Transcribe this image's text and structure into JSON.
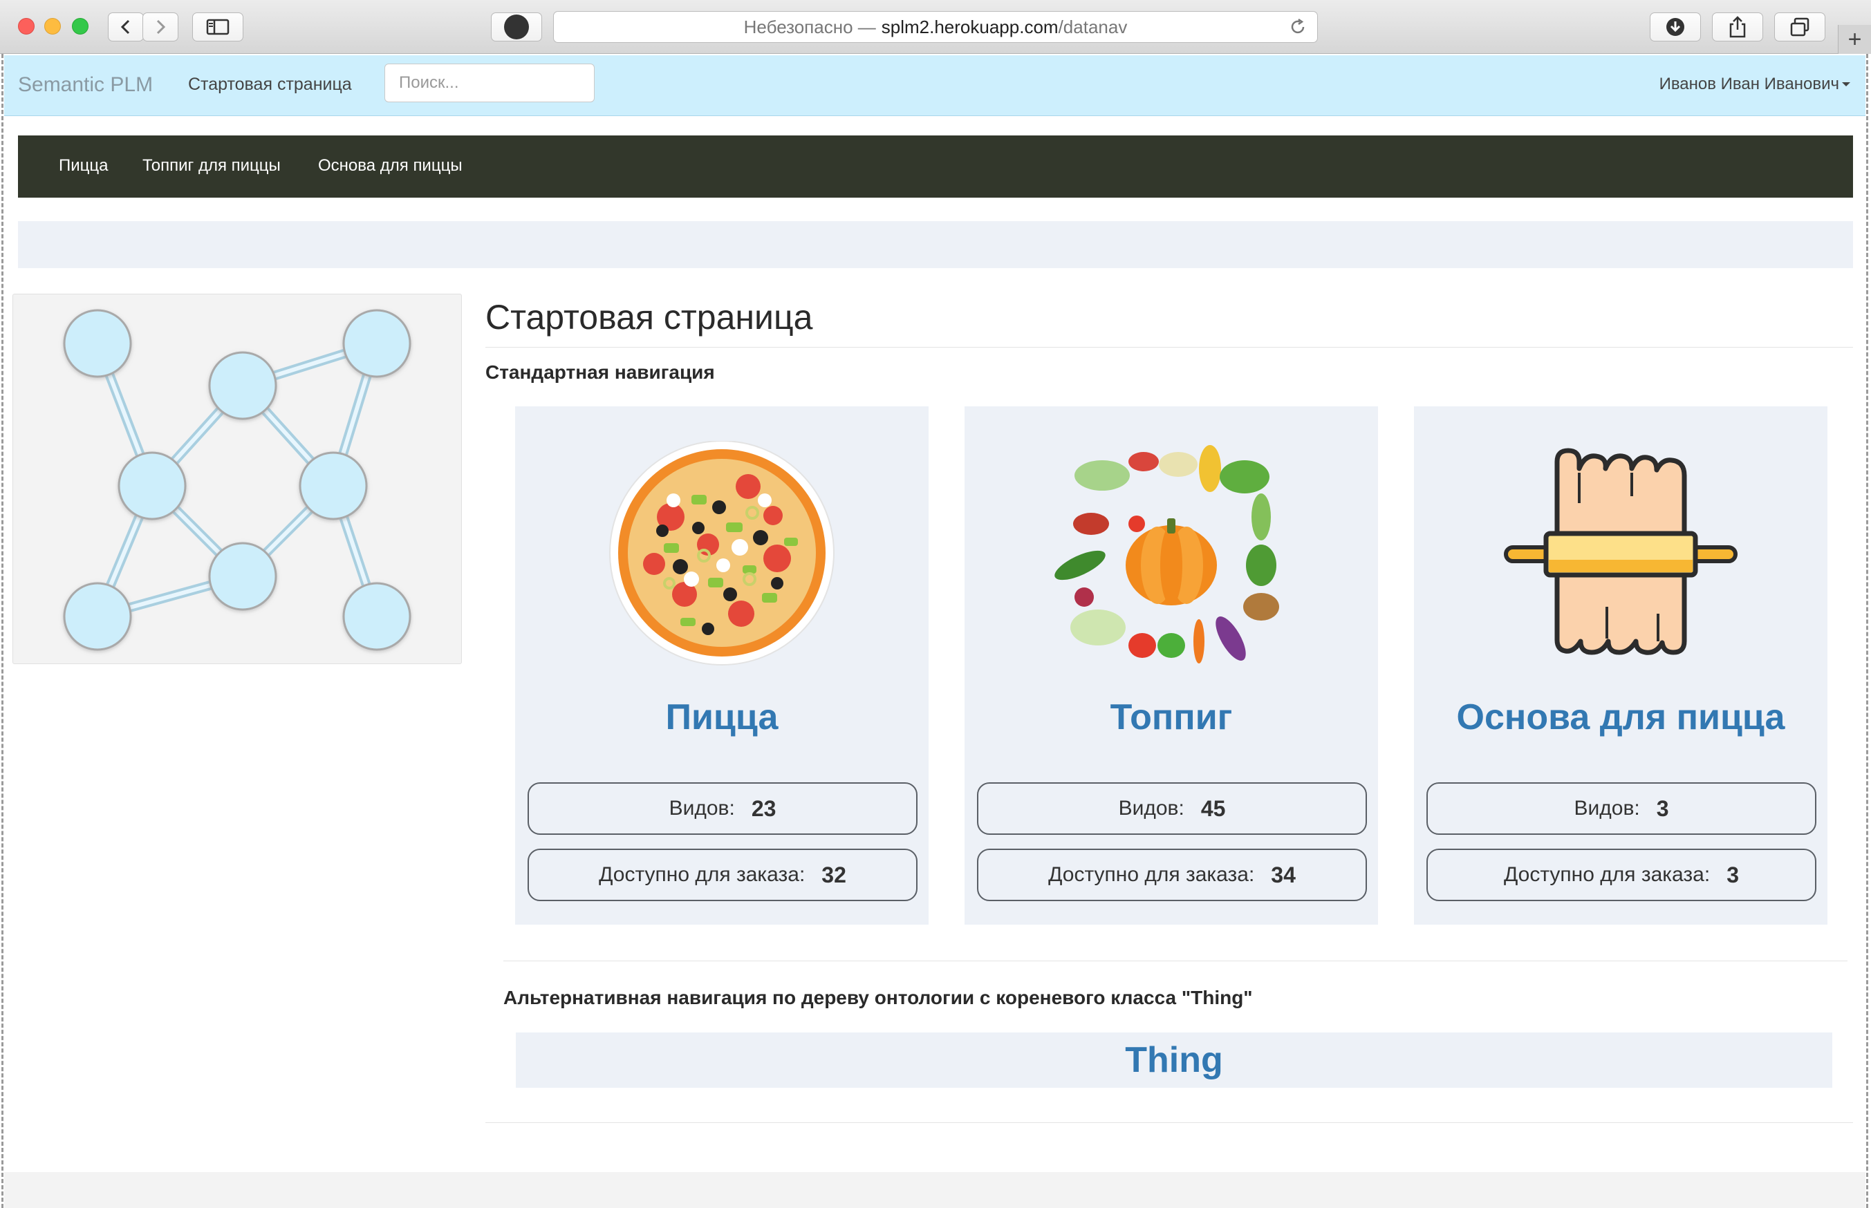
{
  "browser": {
    "url_prefix": "Небезопасно —",
    "url_host": "splm2.herokuapp.com",
    "url_path": "/datanav",
    "new_tab": "+"
  },
  "navbar": {
    "brand": "Semantic PLM",
    "home_link": "Стартовая страница",
    "search_placeholder": "Поиск...",
    "user": "Иванов Иван Иванович"
  },
  "categories": {
    "items": [
      "Пицца",
      "Топпиг для пиццы",
      "Основа для пиццы"
    ]
  },
  "main": {
    "title": "Стартовая страница",
    "standard_nav_label": "Стандартная навигация",
    "cards": [
      {
        "title": "Пицца",
        "kinds_label": "Видов:",
        "kinds": "23",
        "avail_label": "Доступно для заказа:",
        "avail": "32",
        "icon": "pizza-icon"
      },
      {
        "title": "Топпиг",
        "kinds_label": "Видов:",
        "kinds": "45",
        "avail_label": "Доступно для заказа:",
        "avail": "34",
        "icon": "vegetables-icon"
      },
      {
        "title": "Основа для пицца",
        "kinds_label": "Видов:",
        "kinds": "3",
        "avail_label": "Доступно для заказа:",
        "avail": "3",
        "icon": "dough-rolling-pin-icon"
      }
    ],
    "alt_nav_label": "Альтернативная навигация по дереву онтологии с кореневого класса \"Thing\"",
    "root_class": "Thing"
  },
  "colors": {
    "navbar_bg": "#cdeffd",
    "category_bar_bg": "#32372b",
    "card_bg": "#edf1f7",
    "link": "#3278b2",
    "node_fill": "#cdeefb"
  }
}
